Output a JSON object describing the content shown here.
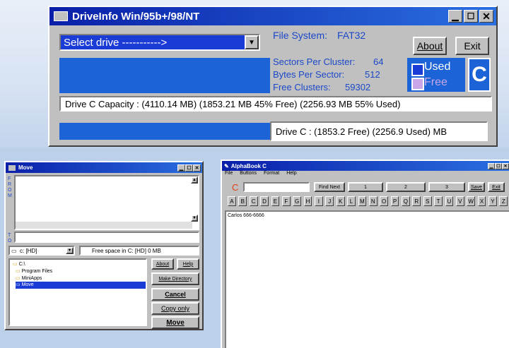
{
  "driveinfo": {
    "title": "DriveInfo Win/95b+/98/NT",
    "select_drive": "Select drive ----------->",
    "file_system_label": "File System:",
    "file_system_value": "FAT32",
    "about_label": "About",
    "exit_label": "Exit",
    "sectors_label": "Sectors Per Cluster:",
    "sectors_value": "64",
    "bytes_label": "Bytes Per Sector:",
    "bytes_value": "512",
    "free_clusters_label": "Free Clusters:",
    "free_clusters_value": "59302",
    "legend_used": "Used",
    "legend_free": "Free",
    "drive_letter": "C",
    "capacity_text": "Drive C Capacity : (4110.14 MB)  (1853.21 MB  45% Free)  (2256.93 MB  55% Used)",
    "summary_text": "Drive C :  (1853.2 Free)  (2256.9 Used)  MB",
    "colors": {
      "bar": "#1b63d6",
      "used": "#1b3bd6",
      "free": "#c8a6e8"
    }
  },
  "move": {
    "title": "Move",
    "from_label": "FROM",
    "to_label": "TO",
    "drive_select": "c: [HD]",
    "free_space": "Free space in C: [HD] 0 MB",
    "folders": [
      "C:\\",
      "Program Files",
      "MiniApps",
      "Move"
    ],
    "about_label": "About",
    "help_label": "Help",
    "make_dir_label": "Make Directory",
    "cancel_label": "Cancel",
    "copy_only_label": "Copy only",
    "move_label": "Move"
  },
  "alphabook": {
    "title": "AlphaBook C",
    "menu": [
      "File",
      "Buttons",
      "Format",
      "Help"
    ],
    "current_letter": "C",
    "find_next_label": "Find Next",
    "page_buttons": [
      "1",
      "2",
      "3"
    ],
    "save_label": "Save",
    "exit_label": "Exit",
    "letters": [
      "A",
      "B",
      "C",
      "D",
      "E",
      "F",
      "G",
      "H",
      "I",
      "J",
      "K",
      "L",
      "M",
      "N",
      "O",
      "P",
      "Q",
      "R",
      "S",
      "T",
      "U",
      "V",
      "W",
      "X",
      "Y",
      "Z"
    ],
    "entry": "Carlos 666-6666"
  }
}
